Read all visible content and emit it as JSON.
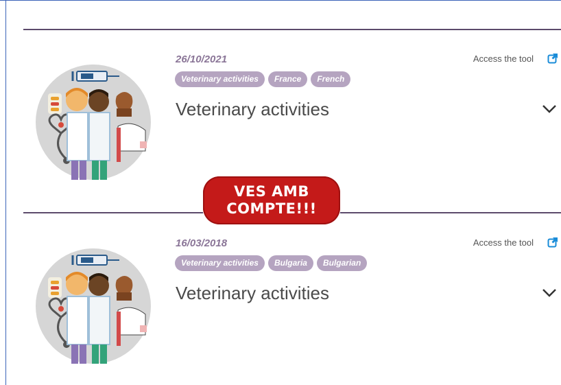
{
  "items": [
    {
      "date": "26/10/2021",
      "tags": [
        "Veterinary activities",
        "France",
        "French"
      ],
      "title": "Veterinary activities",
      "access_label": "Access the tool"
    },
    {
      "date": "16/03/2018",
      "tags": [
        "Veterinary activities",
        "Bulgaria",
        "Bulgarian"
      ],
      "title": "Veterinary activities",
      "access_label": "Access the tool"
    }
  ],
  "annotation": {
    "line1": "VES AMB",
    "line2": "COMPTE!!!"
  },
  "colors": {
    "tag_bg": "#b5a4c0",
    "date": "#8a7597",
    "divider": "#5c4a6b",
    "link_icon": "#1a8cd8",
    "stamp": "#c41a19"
  },
  "icons": [
    "vet-illustration-icon",
    "external-link-icon",
    "chevron-down-icon"
  ]
}
